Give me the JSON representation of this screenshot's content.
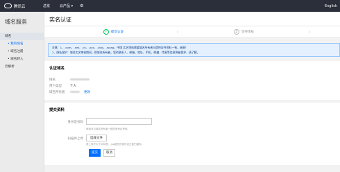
{
  "topbar": {
    "brand": "腾讯云",
    "nav": [
      "总览",
      "云产品 ▾"
    ],
    "right": "English"
  },
  "sidebar": {
    "title": "域名服务",
    "groups": [
      {
        "label": "域名",
        "items": [
          "我的域名",
          "域名注册",
          "域名转入"
        ]
      },
      {
        "label": "云解析",
        "items": []
      }
    ]
  },
  "page": {
    "title": "实名认证"
  },
  "steps": [
    {
      "icon": "✓",
      "label": "提交认证"
    },
    {
      "icon": "2",
      "label": "等待审核"
    }
  ],
  "notice": {
    "line1": "注意：1、.com、.net、.cn、.xyz、.club、.wang、中国 实名审核需要域名所有者与提供证件资料一致，谢谢！",
    "line2": "2、隐私保护：域名实名审核期间，即域名所有者，您的联系人、邮箱、地址、手机、邮编、传真等信息将被保护，请了解。"
  },
  "domain_info": {
    "title": "认证域名",
    "rows": [
      {
        "label": "域名",
        "value": ""
      },
      {
        "label": "用户类型",
        "value": "个人"
      },
      {
        "label": "域名所有者",
        "value": "",
        "link": "更改"
      }
    ]
  },
  "submit": {
    "title": "提交资料",
    "id_label": "身份证号码",
    "id_placeholder": "",
    "id_help": "请填写与域名所有者一致的身份证号码。",
    "upload_label": "扫描件上传",
    "upload_button": "选择文件",
    "upload_help": "请上传不大于2MB的，jpg格式的身份证正面扫描件。",
    "submit_button": "提交",
    "cancel_button": "取消"
  }
}
